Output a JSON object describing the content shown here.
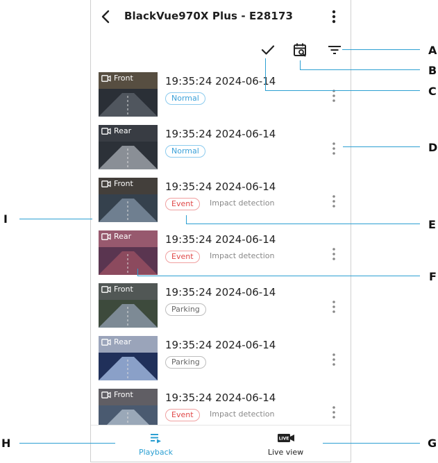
{
  "header": {
    "title": "BlackVue970X Plus - E28173"
  },
  "toolbar": {
    "select_icon": "checkmark-icon",
    "calendar_icon": "calendar-search-icon",
    "filter_icon": "filter-icon"
  },
  "recordings": [
    {
      "camera": "Front",
      "time": "19:35:24  2024-06-14",
      "type": "Normal",
      "kind": "normal",
      "detail": ""
    },
    {
      "camera": "Rear",
      "time": "19:35:24  2024-06-14",
      "type": "Normal",
      "kind": "normal",
      "detail": ""
    },
    {
      "camera": "Front",
      "time": "19:35:24  2024-06-14",
      "type": "Event",
      "kind": "event",
      "detail": "Impact detection"
    },
    {
      "camera": "Rear",
      "time": "19:35:24  2024-06-14",
      "type": "Event",
      "kind": "event",
      "detail": "Impact detection"
    },
    {
      "camera": "Front",
      "time": "19:35:24  2024-06-14",
      "type": "Parking",
      "kind": "parking",
      "detail": ""
    },
    {
      "camera": "Rear",
      "time": "19:35:24  2024-06-14",
      "type": "Parking",
      "kind": "parking",
      "detail": ""
    },
    {
      "camera": "Front",
      "time": "19:35:24  2024-06-14",
      "type": "Event",
      "kind": "event",
      "detail": "Impact detection"
    }
  ],
  "bottom_nav": [
    {
      "label": "Playback",
      "active": true,
      "icon": "playback-list-icon"
    },
    {
      "label": "Live view",
      "active": false,
      "icon": "live-camera-icon"
    }
  ],
  "callouts": {
    "A": "A",
    "B": "B",
    "C": "C",
    "D": "D",
    "E": "E",
    "F": "F",
    "G": "G",
    "H": "H",
    "I": "I"
  },
  "colors": {
    "accent": "#2b9fd2",
    "event": "#e04848",
    "normal": "#3aa0d8"
  }
}
